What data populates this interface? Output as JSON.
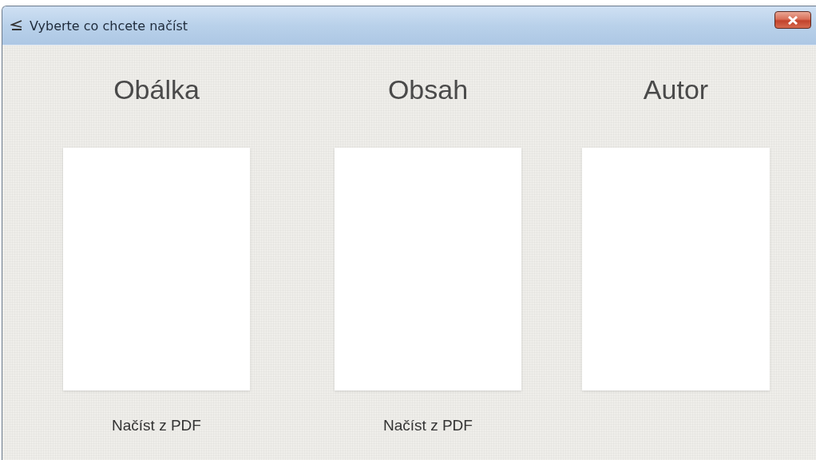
{
  "window": {
    "title": "Vyberte co chcete načíst"
  },
  "columns": [
    {
      "heading": "Obálka",
      "action": "Načíst z PDF"
    },
    {
      "heading": "Obsah",
      "action": "Načíst z PDF"
    },
    {
      "heading": "Autor"
    }
  ]
}
